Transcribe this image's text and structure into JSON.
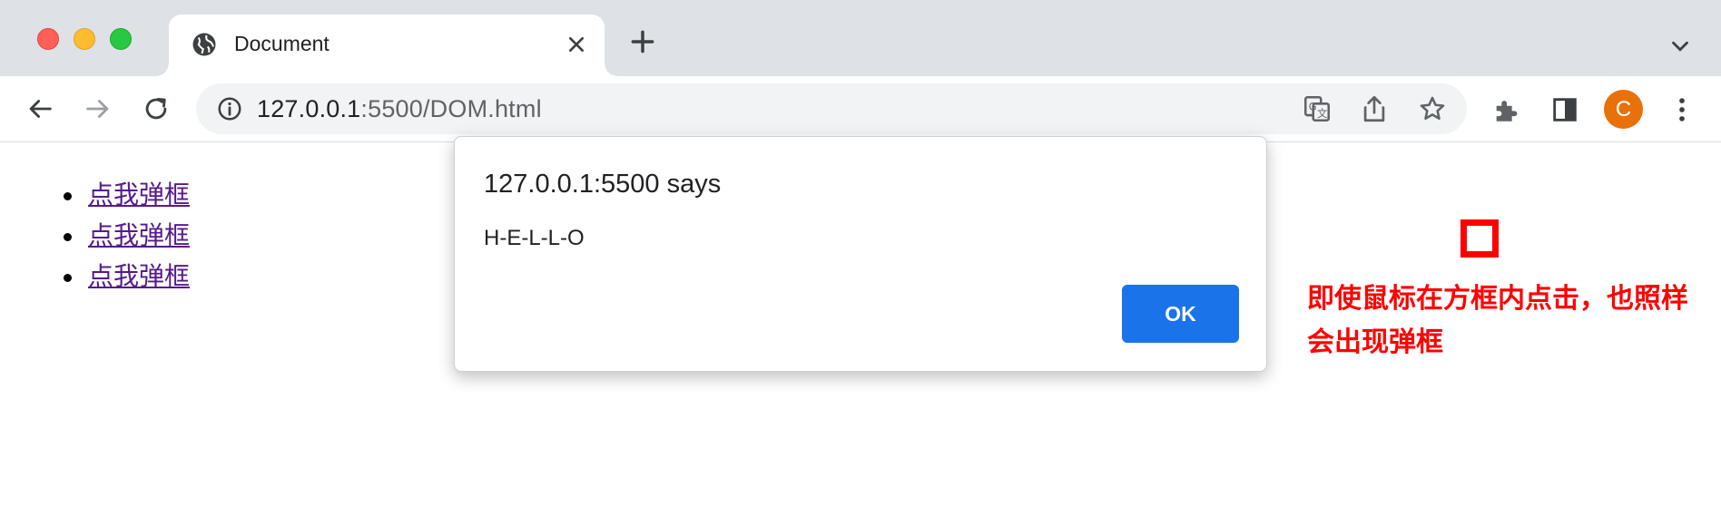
{
  "browser": {
    "tab": {
      "title": "Document",
      "icon": "globe-icon"
    },
    "address_bar": {
      "host": "127.0.0.1",
      "path": ":5500/DOM.html"
    },
    "profile_initial": "C",
    "colors": {
      "tabstrip": "#dee1e6",
      "accent": "#1a73e8",
      "profile": "#e8710a"
    }
  },
  "page": {
    "links": [
      "点我弹框",
      "点我弹框",
      "点我弹框"
    ],
    "annotation": "即使鼠标在方框内点击，也照样会出现弹框",
    "colors": {
      "link": "#551a8b",
      "annotation": "#ff0000"
    }
  },
  "dialog": {
    "title": "127.0.0.1:5500 says",
    "message": "H-E-L-L-O",
    "ok_label": "OK"
  }
}
